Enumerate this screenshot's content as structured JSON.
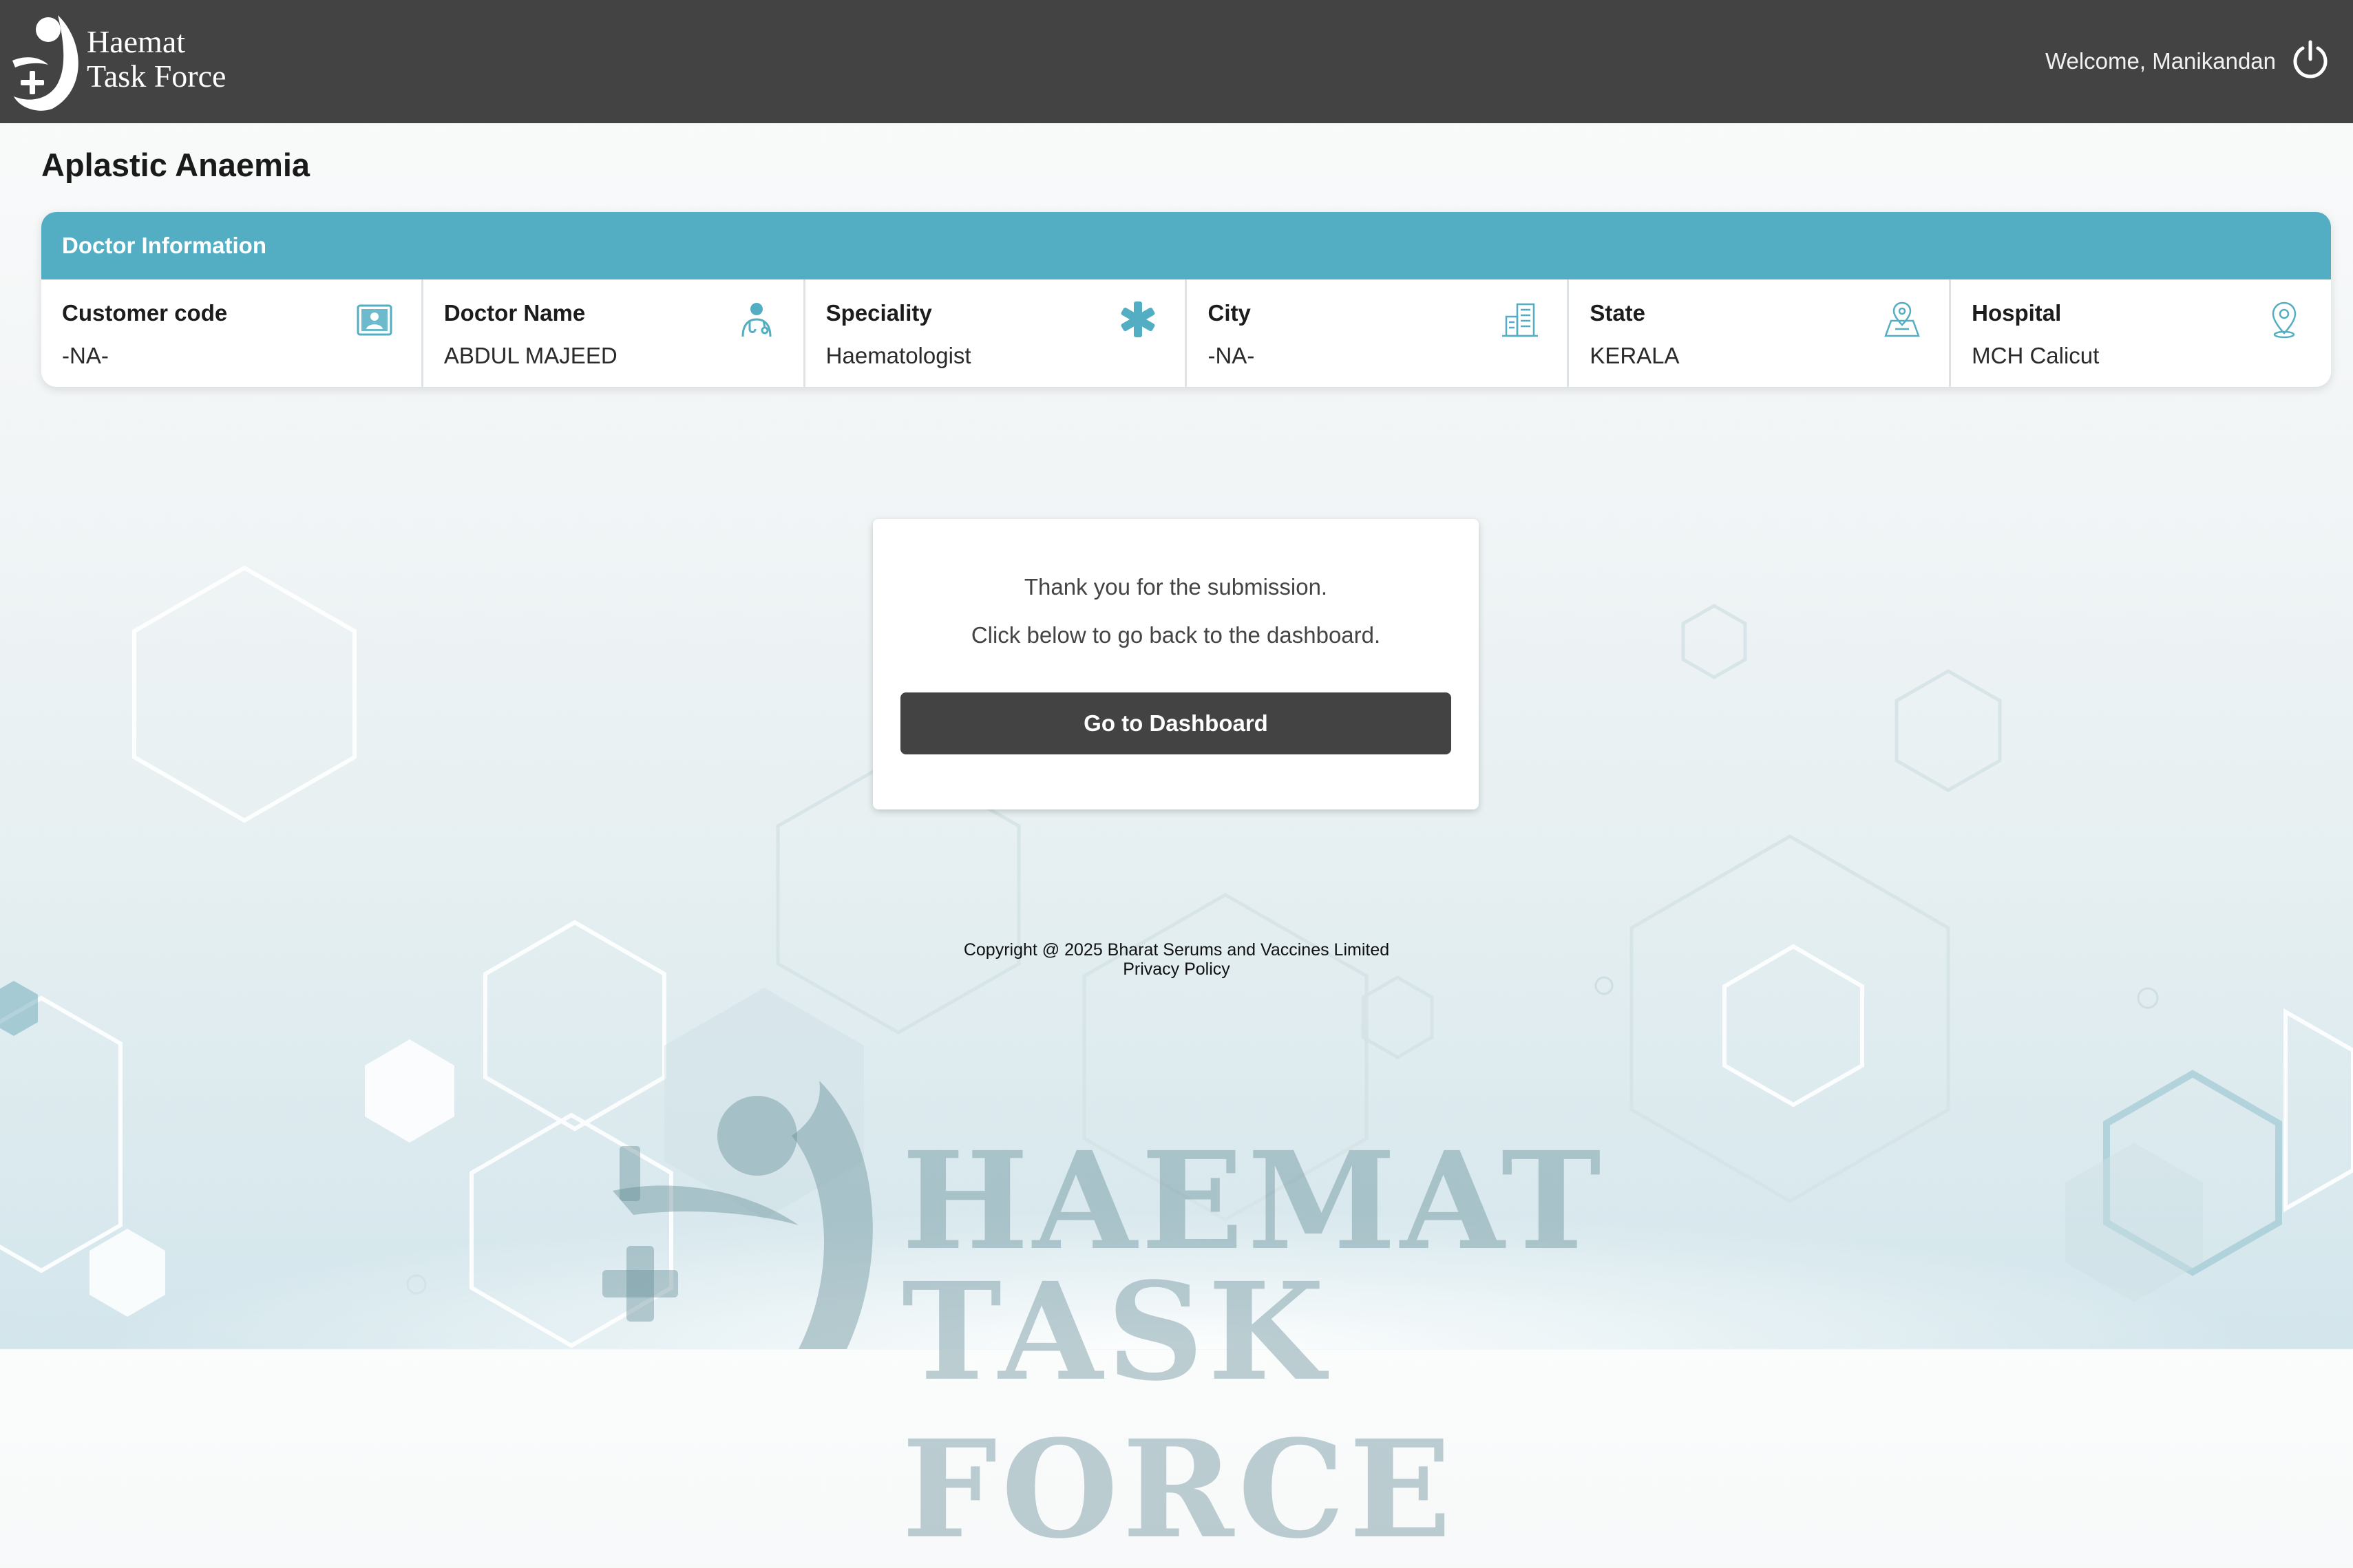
{
  "header": {
    "logo_line1": "Haemat",
    "logo_line2": "Task Force",
    "welcome": "Welcome, Manikandan",
    "power_icon": "power-icon"
  },
  "page": {
    "title": "Aplastic Anaemia"
  },
  "doctor_info": {
    "heading": "Doctor Information",
    "fields": [
      {
        "label": "Customer code",
        "value": "-NA-",
        "icon": "id-card-icon"
      },
      {
        "label": "Doctor Name",
        "value": "ABDUL MAJEED",
        "icon": "doctor-icon"
      },
      {
        "label": "Speciality",
        "value": "Haematologist",
        "icon": "medical-star-icon"
      },
      {
        "label": "City",
        "value": "-NA-",
        "icon": "building-icon"
      },
      {
        "label": "State",
        "value": "KERALA",
        "icon": "map-icon"
      },
      {
        "label": "Hospital",
        "value": "MCH Calicut",
        "icon": "location-pin-icon"
      }
    ]
  },
  "confirmation": {
    "line1": "Thank you for the submission.",
    "line2": "Click below to go back to the dashboard.",
    "button_label": "Go to Dashboard"
  },
  "footer": {
    "copyright": "Copyright @ 2025 Bharat Serums and Vaccines Limited",
    "privacy": "Privacy Policy"
  },
  "watermark": {
    "line1": "HAEMAT",
    "line2": "TASK FORCE"
  },
  "colors": {
    "header_bg": "#434343",
    "accent": "#54aec3",
    "button_bg": "#434343"
  }
}
